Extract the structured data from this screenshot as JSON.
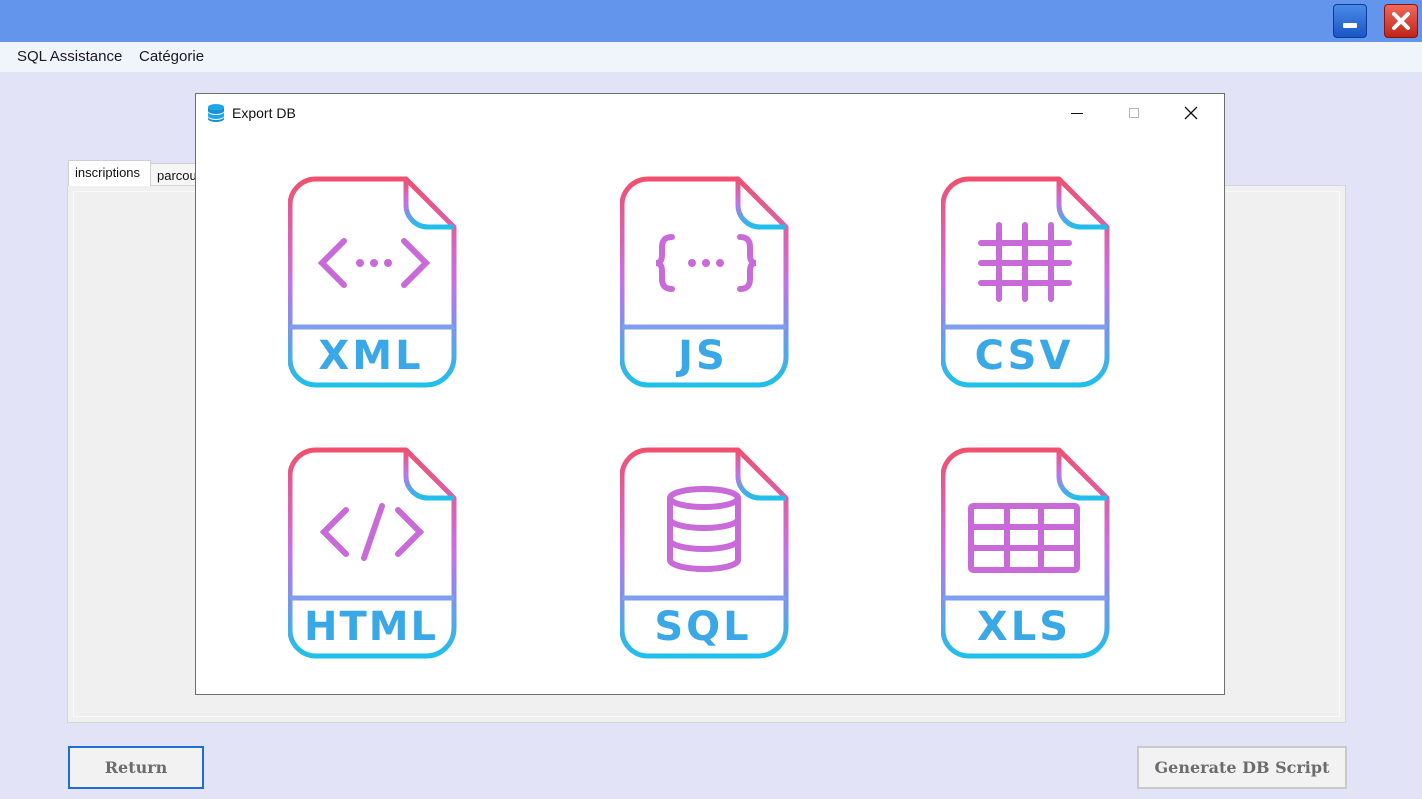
{
  "menu": {
    "items": [
      "SQL Assistance",
      "Catégorie"
    ]
  },
  "tabs": [
    {
      "label": "inscriptions",
      "active": true
    },
    {
      "label": "parcou",
      "active": false
    }
  ],
  "dialog": {
    "title": "Export DB",
    "formats": [
      "XML",
      "JS",
      "CSV",
      "HTML",
      "SQL",
      "XLS"
    ]
  },
  "buttons": {
    "return": "Return",
    "generate": "Generate DB Script"
  },
  "colors": {
    "gradient_top": "#f0506e",
    "gradient_mid": "#c472e6",
    "gradient_bottom": "#1ec0ea",
    "titlebar": "#6495ed"
  }
}
